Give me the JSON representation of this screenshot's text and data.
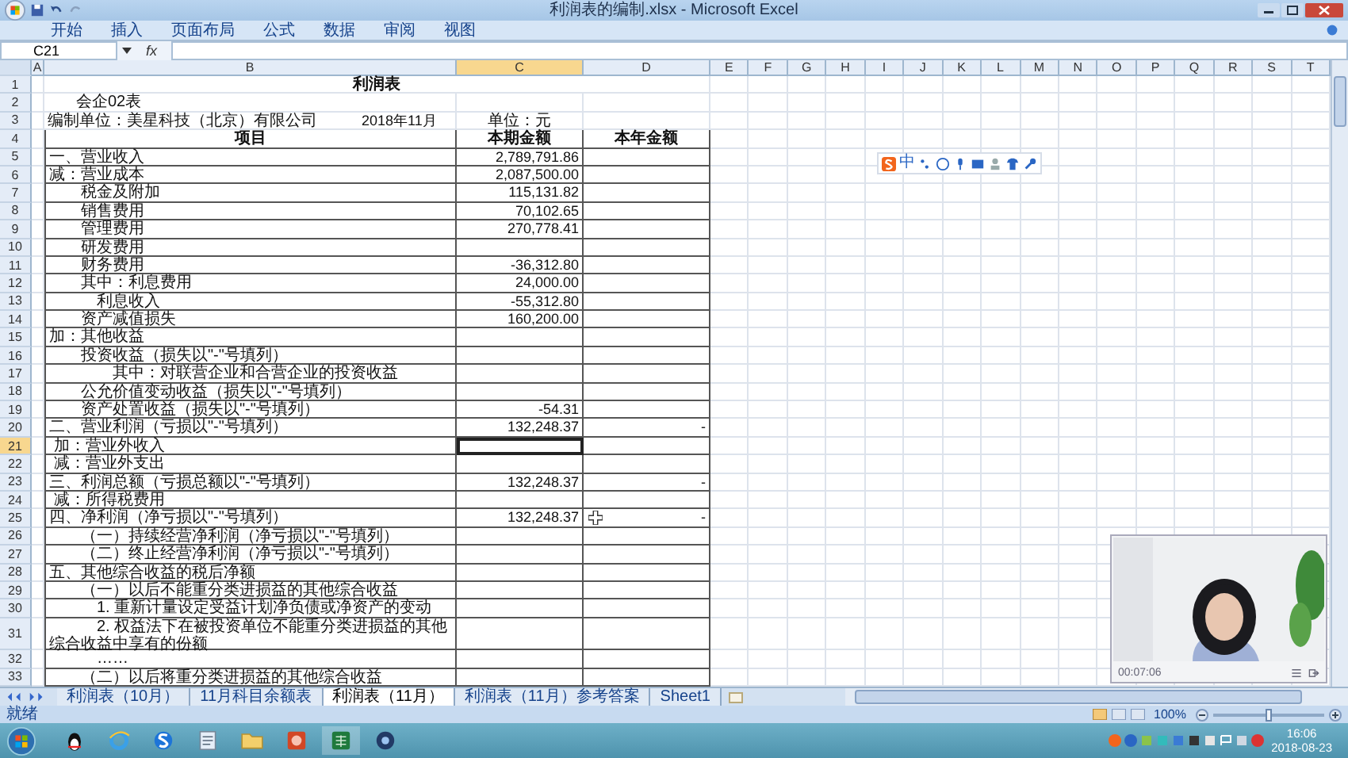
{
  "window": {
    "title": "利润表的编制.xlsx - Microsoft Excel"
  },
  "ribbon_tabs": [
    {
      "label": "开始"
    },
    {
      "label": "插入"
    },
    {
      "label": "页面布局"
    },
    {
      "label": "公式"
    },
    {
      "label": "数据"
    },
    {
      "label": "审阅"
    },
    {
      "label": "视图"
    }
  ],
  "formula_bar": {
    "name_box": "C21",
    "fx": "fx"
  },
  "columns": [
    {
      "label": "A",
      "selected": false
    },
    {
      "label": "B",
      "selected": false
    },
    {
      "label": "C",
      "selected": true
    },
    {
      "label": "D",
      "selected": false
    },
    {
      "label": "E",
      "selected": false
    },
    {
      "label": "F",
      "selected": false
    },
    {
      "label": "G",
      "selected": false
    },
    {
      "label": "H",
      "selected": false
    },
    {
      "label": "I",
      "selected": false
    },
    {
      "label": "J",
      "selected": false
    },
    {
      "label": "K",
      "selected": false
    },
    {
      "label": "L",
      "selected": false
    },
    {
      "label": "M",
      "selected": false
    },
    {
      "label": "N",
      "selected": false
    },
    {
      "label": "O",
      "selected": false
    },
    {
      "label": "P",
      "selected": false
    },
    {
      "label": "Q",
      "selected": false
    },
    {
      "label": "R",
      "selected": false
    },
    {
      "label": "S",
      "selected": false
    },
    {
      "label": "T",
      "selected": false
    }
  ],
  "rows": [
    {
      "num": "1",
      "selected": false,
      "kind": "title",
      "b": "利润表"
    },
    {
      "num": "2",
      "selected": false,
      "kind": "note",
      "b": "会企02表"
    },
    {
      "num": "3",
      "selected": false,
      "kind": "info",
      "b": "编制单位：美星科技（北京）有限公司",
      "b_extra": "2018年11月",
      "c": "单位：元"
    },
    {
      "num": "4",
      "selected": false,
      "kind": "header",
      "b": "项目",
      "c": "本期金额",
      "d": "本年金额"
    },
    {
      "num": "5",
      "selected": false,
      "kind": "line",
      "b": "一、营业收入",
      "c": "2,789,791.86"
    },
    {
      "num": "6",
      "selected": false,
      "kind": "line",
      "b": "减：营业成本",
      "c": "2,087,500.00"
    },
    {
      "num": "7",
      "selected": false,
      "kind": "line",
      "b": "　　税金及附加",
      "c": "115,131.82"
    },
    {
      "num": "8",
      "selected": false,
      "kind": "line",
      "b": "　　销售费用",
      "c": "70,102.65"
    },
    {
      "num": "9",
      "selected": false,
      "kind": "line",
      "b": "　　管理费用",
      "c": "270,778.41"
    },
    {
      "num": "10",
      "selected": false,
      "kind": "line",
      "b": "　　研发费用"
    },
    {
      "num": "11",
      "selected": false,
      "kind": "line",
      "b": "　　财务费用",
      "c": "-36,312.80"
    },
    {
      "num": "12",
      "selected": false,
      "kind": "line",
      "b": "　　其中：利息费用",
      "c": "24,000.00"
    },
    {
      "num": "13",
      "selected": false,
      "kind": "line",
      "b": "　　　利息收入",
      "c": "-55,312.80"
    },
    {
      "num": "14",
      "selected": false,
      "kind": "line",
      "b": "　　资产减值损失",
      "c": "160,200.00"
    },
    {
      "num": "15",
      "selected": false,
      "kind": "line",
      "b": "加：其他收益"
    },
    {
      "num": "16",
      "selected": false,
      "kind": "line",
      "b": "　　投资收益（损失以\"-\"号填列）"
    },
    {
      "num": "17",
      "selected": false,
      "kind": "line",
      "b": "　　　　其中：对联营企业和合营企业的投资收益"
    },
    {
      "num": "18",
      "selected": false,
      "kind": "line",
      "b": "　　公允价值变动收益（损失以\"-\"号填列）"
    },
    {
      "num": "19",
      "selected": false,
      "kind": "line",
      "b": "　　资产处置收益（损失以\"-\"号填列）",
      "c": "-54.31"
    },
    {
      "num": "20",
      "selected": false,
      "kind": "line",
      "b": "二、营业利润（亏损以\"-\"号填列）",
      "c": "132,248.37",
      "d": "-"
    },
    {
      "num": "21",
      "selected": true,
      "kind": "line",
      "b": " 加：营业外收入",
      "c_selected": true
    },
    {
      "num": "22",
      "selected": false,
      "kind": "line",
      "b": " 减：营业外支出"
    },
    {
      "num": "23",
      "selected": false,
      "kind": "line",
      "b": "三、利润总额（亏损总额以\"-\"号填列）",
      "c": "132,248.37",
      "d": "-"
    },
    {
      "num": "24",
      "selected": false,
      "kind": "line",
      "b": " 减：所得税费用"
    },
    {
      "num": "25",
      "selected": false,
      "kind": "line",
      "b": "四、净利润（净亏损以\"-\"号填列）",
      "c": "132,248.37",
      "d": "-"
    },
    {
      "num": "26",
      "selected": false,
      "kind": "line",
      "b": "　　（一）持续经营净利润（净亏损以\"-\"号填列）"
    },
    {
      "num": "27",
      "selected": false,
      "kind": "line",
      "b": "　　（二）终止经营净利润（净亏损以\"-\"号填列）"
    },
    {
      "num": "28",
      "selected": false,
      "kind": "line",
      "b": "五、其他综合收益的税后净额"
    },
    {
      "num": "29",
      "selected": false,
      "kind": "line",
      "b": "　　（一）以后不能重分类进损益的其他综合收益"
    },
    {
      "num": "30",
      "selected": false,
      "kind": "line",
      "b": "　　　1. 重新计量设定受益计划净负债或净资产的变动"
    },
    {
      "num": "31",
      "selected": false,
      "kind": "line",
      "b": "　　　2. 权益法下在被投资单位不能重分类进损益的其他综合收益中享有的份额"
    },
    {
      "num": "32",
      "selected": false,
      "kind": "line",
      "b": "　　　……"
    },
    {
      "num": "33",
      "selected": false,
      "kind": "line",
      "b": "　　（二）以后将重分类进损益的其他综合收益"
    }
  ],
  "ime_toolbar": {
    "mode": "中"
  },
  "video": {
    "time": "00:07:06"
  },
  "sheet_tabs": [
    {
      "label": "利润表（10月）",
      "selected": false
    },
    {
      "label": "11月科目余额表",
      "selected": false
    },
    {
      "label": "利润表（11月）",
      "selected": true
    },
    {
      "label": "利润表（11月）参考答案",
      "selected": false
    },
    {
      "label": "Sheet1",
      "selected": false
    }
  ],
  "status_bar": {
    "text": "就绪",
    "zoom": "100%",
    "level": 0.5
  },
  "taskbar": {
    "time": "16:06",
    "date": "2018-08-23"
  }
}
